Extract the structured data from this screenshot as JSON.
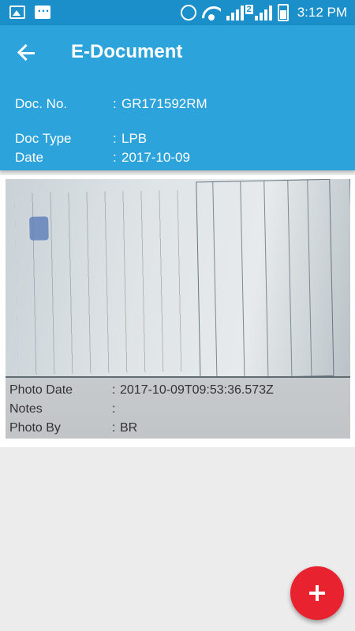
{
  "status_bar": {
    "time": "3:12 PM",
    "sim_number": "2",
    "icons": [
      "gallery-icon",
      "chat-icon",
      "alarm-icon",
      "wifi-icon",
      "signal-icon",
      "battery-icon"
    ]
  },
  "app_bar": {
    "title": "E-Document",
    "back_icon": "arrow-left-icon"
  },
  "document": {
    "doc_no_label": "Doc. No.",
    "doc_no": "GR171592RM",
    "doc_type_label": "Doc Type",
    "doc_type": "LPB",
    "date_label": "Date",
    "date": "2017-10-09",
    "separator": ":"
  },
  "photo": {
    "photo_date_label": "Photo Date",
    "photo_date": "2017-10-09T09:53:36.573Z",
    "notes_label": "Notes",
    "notes": "",
    "photo_by_label": "Photo By",
    "photo_by": "BR",
    "separator": ":"
  },
  "fab": {
    "icon": "plus-icon"
  },
  "colors": {
    "status_bar": "#1a8fc9",
    "app_bar": "#2ca3db",
    "background": "#ececec",
    "fab": "#e8232f"
  }
}
